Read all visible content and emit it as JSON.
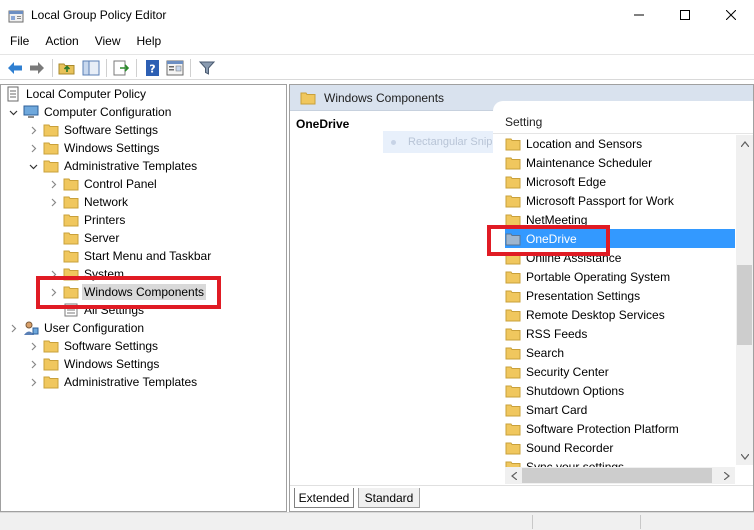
{
  "window": {
    "title": "Local Group Policy Editor",
    "buttons": [
      "minimize-icon",
      "maximize-icon",
      "close-icon"
    ]
  },
  "menu": [
    "File",
    "Action",
    "View",
    "Help"
  ],
  "toolbar": {
    "icons": [
      "back-icon",
      "forward-icon",
      "up-folder-icon",
      "show-hide-tree-icon",
      "export-list-icon",
      "help-icon",
      "properties-icon",
      "filter-icon"
    ]
  },
  "tree": {
    "root": "Local Computer Policy",
    "computer_config": "Computer Configuration",
    "cc_software": "Software Settings",
    "cc_windows": "Windows Settings",
    "cc_admin": "Administrative Templates",
    "control_panel": "Control Panel",
    "network": "Network",
    "printers": "Printers",
    "server": "Server",
    "start_menu": "Start Menu and Taskbar",
    "system": "System",
    "windows_components": "Windows Components",
    "all_settings": "All Settings",
    "user_config": "User Configuration",
    "uc_software": "Software Settings",
    "uc_windows": "Windows Settings",
    "uc_admin": "Administrative Templates"
  },
  "right": {
    "header": "Windows Components",
    "description_title": "OneDrive",
    "drag_ghost": "Rectangular Snip",
    "column_header": "Setting",
    "items": [
      "Location and Sensors",
      "Maintenance Scheduler",
      "Microsoft Edge",
      "Microsoft Passport for Work",
      "NetMeeting",
      "OneDrive",
      "Online Assistance",
      "Portable Operating System",
      "Presentation Settings",
      "Remote Desktop Services",
      "RSS Feeds",
      "Search",
      "Security Center",
      "Shutdown Options",
      "Smart Card",
      "Software Protection Platform",
      "Sound Recorder",
      "Sync your settings"
    ],
    "selected_item": "OneDrive"
  },
  "tabs": {
    "extended": "Extended",
    "standard": "Standard"
  },
  "colors": {
    "selection": "#3399ff",
    "highlight_box": "#e01b24",
    "folder": "#f0c75e",
    "header_band": "#d9e2ee"
  }
}
